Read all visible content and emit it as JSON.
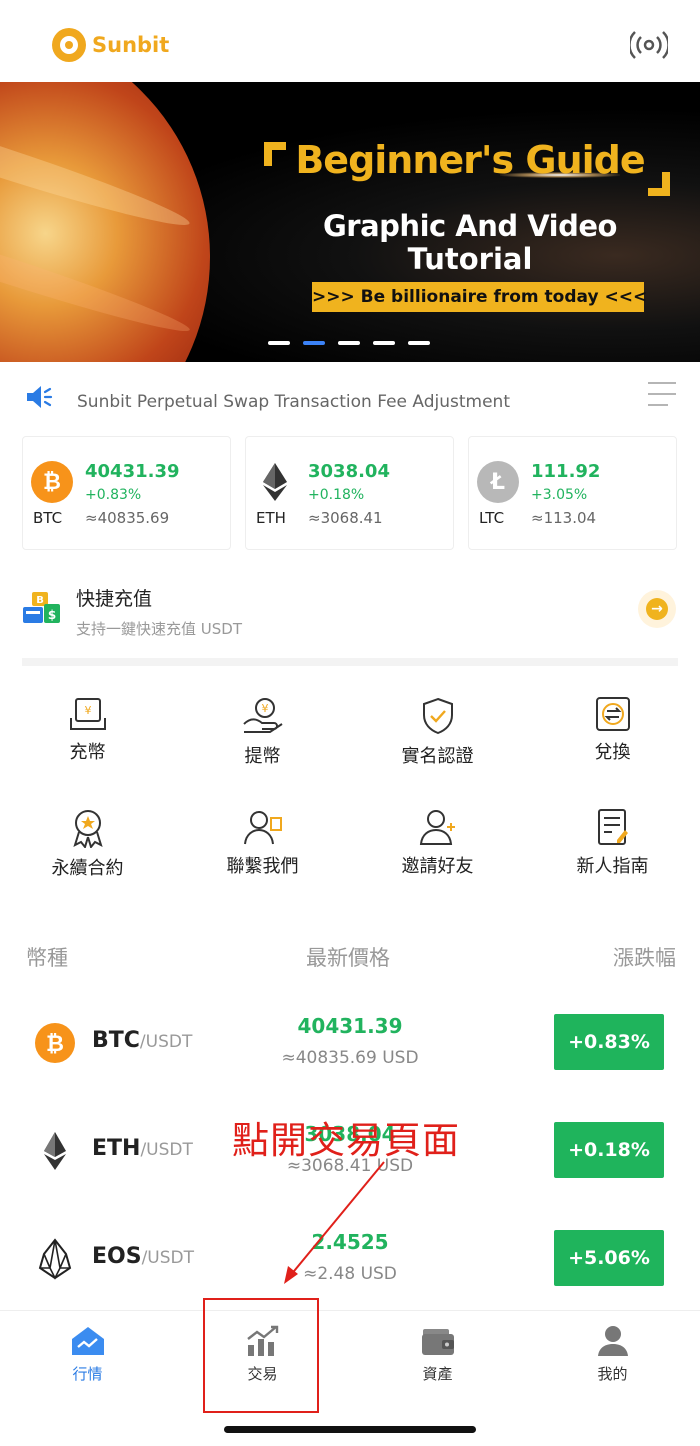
{
  "app": {
    "logo_text": "Sunbit",
    "icons": {
      "broadcast": "broadcast-icon"
    }
  },
  "banner": {
    "title": "Beginner's Guide",
    "subtitle_line1": "Graphic And Video",
    "subtitle_line2": "Tutorial",
    "tagline": ">>> Be billionaire from today <<<",
    "active_slide": 2,
    "slide_count": 5
  },
  "notice": {
    "text": "Sunbit Perpetual Swap Transaction Fee Adjustment"
  },
  "tickers": [
    {
      "symbol": "BTC",
      "price": "40431.39",
      "change": "+0.83%",
      "approx": "≈40835.69",
      "icon": "bitcoin-icon",
      "color": "#f7931a"
    },
    {
      "symbol": "ETH",
      "price": "3038.04",
      "change": "+0.18%",
      "approx": "≈3068.41",
      "icon": "ethereum-icon",
      "color": "#333333"
    },
    {
      "symbol": "LTC",
      "price": "111.92",
      "change": "+3.05%",
      "approx": "≈113.04",
      "icon": "litecoin-icon",
      "color": "#b8b8b8"
    }
  ],
  "quick_charge": {
    "title": "快捷充值",
    "description": "支持一鍵快速充值 USDT"
  },
  "actions": [
    {
      "label": "充幣",
      "icon": "deposit-icon"
    },
    {
      "label": "提幣",
      "icon": "withdraw-icon"
    },
    {
      "label": "實名認證",
      "icon": "verify-shield-icon"
    },
    {
      "label": "兌換",
      "icon": "exchange-icon"
    },
    {
      "label": "永續合約",
      "icon": "award-icon"
    },
    {
      "label": "聯繫我們",
      "icon": "contact-icon"
    },
    {
      "label": "邀請好友",
      "icon": "invite-icon"
    },
    {
      "label": "新人指南",
      "icon": "guide-icon"
    }
  ],
  "market": {
    "headers": {
      "coin": "幣種",
      "price": "最新價格",
      "change": "漲跌幅"
    },
    "rows": [
      {
        "base": "BTC",
        "quote": "/USDT",
        "price": "40431.39",
        "fiat": "≈40835.69 USD",
        "change": "+0.83%",
        "icon": "bitcoin-icon"
      },
      {
        "base": "ETH",
        "quote": "/USDT",
        "price": "3038.04",
        "fiat": "≈3068.41 USD",
        "change": "+0.18%",
        "icon": "ethereum-icon"
      },
      {
        "base": "EOS",
        "quote": "/USDT",
        "price": "2.4525",
        "fiat": "≈2.48 USD",
        "change": "+5.06%",
        "icon": "eos-icon"
      }
    ]
  },
  "annotation": {
    "text": "點開交易頁面"
  },
  "tabbar": [
    {
      "label": "行情",
      "icon": "market-home-icon",
      "active": true
    },
    {
      "label": "交易",
      "icon": "trade-chart-icon",
      "active": false
    },
    {
      "label": "資產",
      "icon": "wallet-icon",
      "active": false
    },
    {
      "label": "我的",
      "icon": "profile-icon",
      "active": false
    }
  ],
  "colors": {
    "brand": "#f0a81e",
    "up": "#21b35e",
    "tab_active": "#2a7be4",
    "annotation": "#e0201a"
  }
}
